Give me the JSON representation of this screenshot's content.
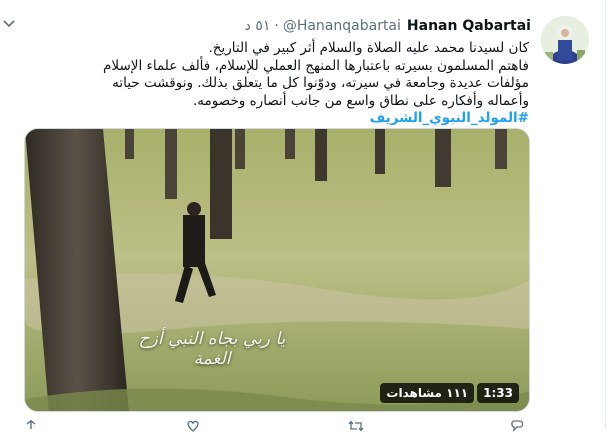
{
  "tweet": {
    "author_name": "Hanan Qabartai",
    "handle": "@Hananqabartai",
    "separator": "·",
    "time": "٥١ د",
    "lines": [
      "كان لسيدنا محمد عليه الصلاة والسلام أثر كبير في التاريخ.",
      "فاهتم المسلمون بسيرته باعتبارها المنهج العملي للإسلام، فألف علماء الإسلام مؤلفات عديدة وجامعة في سيرته، ودوّنوا كل ما يتعلق بذلك. ونوقشت حياته وأعماله وأفكاره على نطاق واسع من جانب أنصاره وخصومه."
    ],
    "hashtag": "#المولد_النبوي_الشريف"
  },
  "video": {
    "duration": "1:33",
    "views": "١١١ مشاهدات",
    "overlay_caption": "يا ربي بجاه النبي أزح الغمة"
  },
  "icons": {
    "more": "chevron-down-icon",
    "reply": "reply-icon",
    "retweet": "retweet-icon",
    "like": "like-icon",
    "share": "share-icon"
  },
  "colors": {
    "link": "#1da1f2",
    "secondary_text": "#5b7083",
    "border": "#e6ecf0"
  }
}
